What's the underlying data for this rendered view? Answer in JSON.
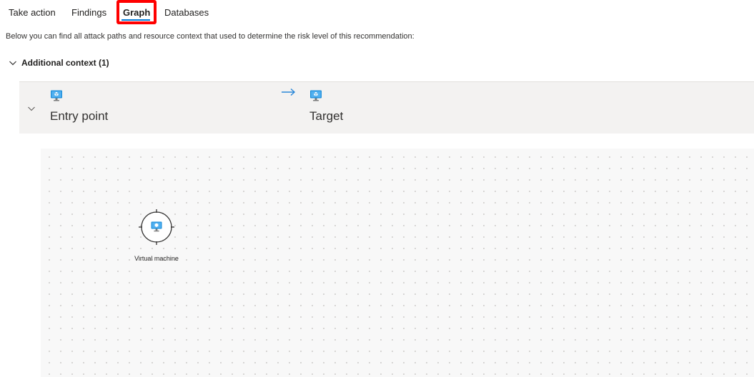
{
  "tabs": [
    {
      "label": "Take action"
    },
    {
      "label": "Findings"
    },
    {
      "label": "Graph"
    },
    {
      "label": "Databases"
    }
  ],
  "description": "Below you can find all attack paths and resource context that used to determine the risk level of this recommendation:",
  "additional_context": {
    "title": "Additional context (1)"
  },
  "attack_path": {
    "entry_label": "Entry point",
    "target_label": "Target",
    "entry_icon": "virtual-machine-icon",
    "target_icon": "virtual-machine-icon",
    "arrow_icon": "arrow-right-icon"
  },
  "graph": {
    "node_label": "Virtual machine",
    "node_icon": "virtual-machine-icon"
  },
  "colors": {
    "accent": "#0078d4",
    "highlight": "#ff0000",
    "vm_blue": "#1a8cd8",
    "row_bg": "#f3f2f1",
    "canvas_bg": "#f8f8f8"
  }
}
